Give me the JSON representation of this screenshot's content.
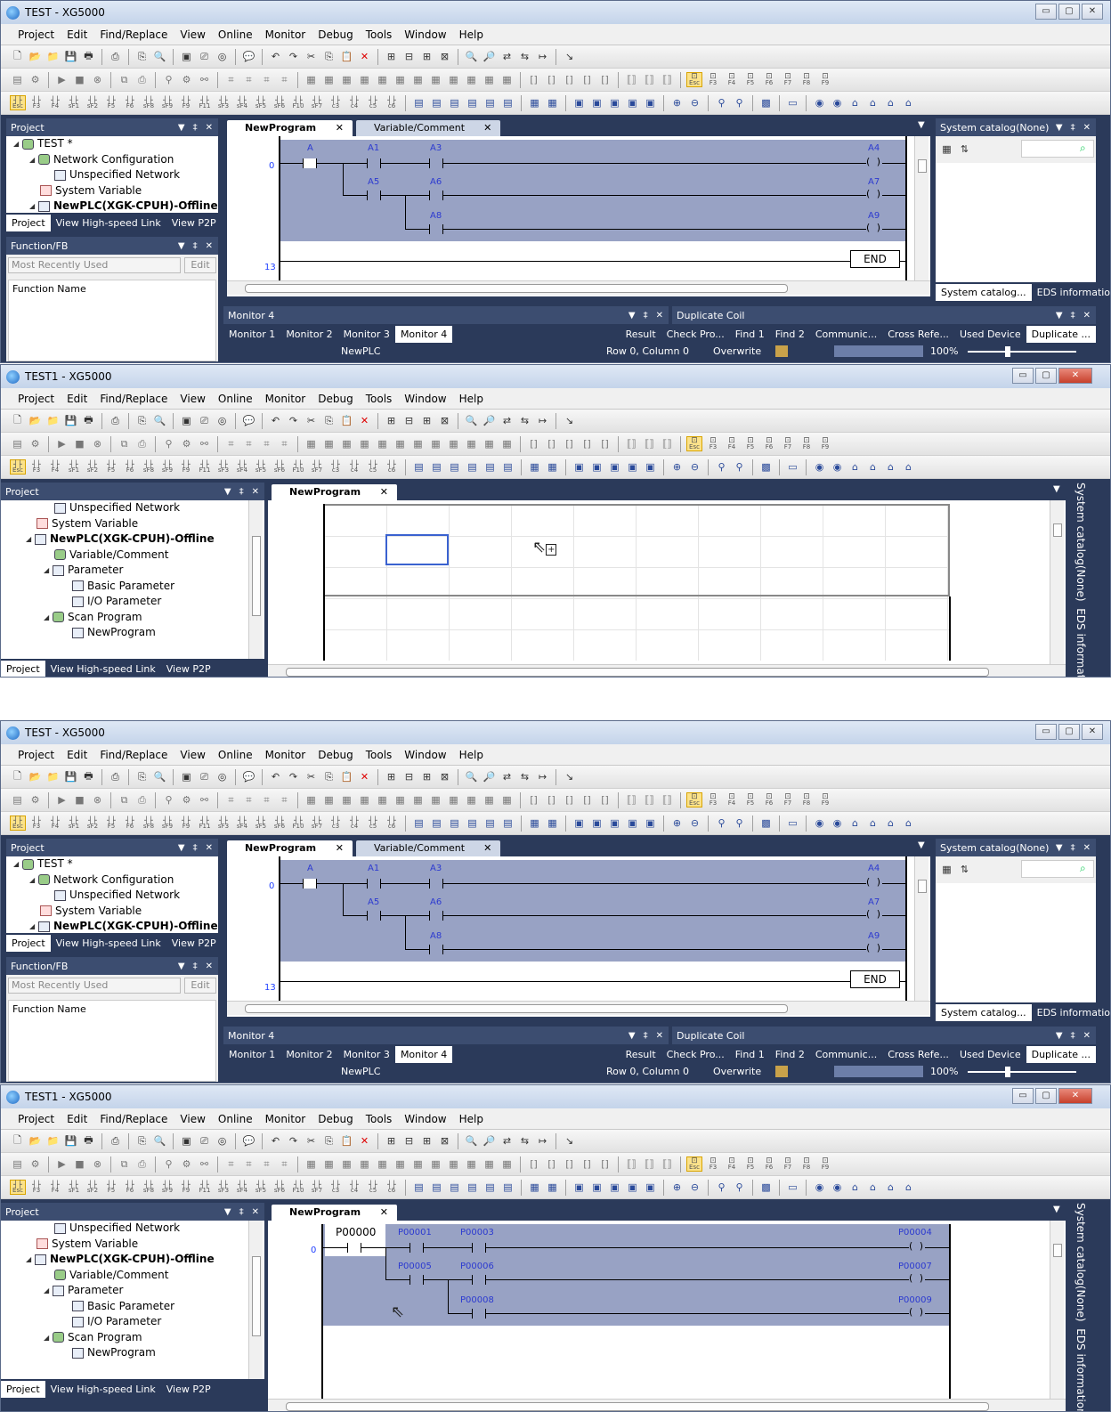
{
  "menu": [
    "Project",
    "Edit",
    "Find/Replace",
    "View",
    "Online",
    "Monitor",
    "Debug",
    "Tools",
    "Window",
    "Help"
  ],
  "fkeys": [
    [
      "Esc",
      ""
    ],
    [
      "F3",
      ""
    ],
    [
      "F4",
      ""
    ],
    [
      "sF1",
      ""
    ],
    [
      "sF2",
      ""
    ],
    [
      "F5",
      ""
    ],
    [
      "F6",
      ""
    ],
    [
      "sF8",
      ""
    ],
    [
      "sF9",
      ""
    ],
    [
      "F9",
      ""
    ],
    [
      "F11",
      ""
    ],
    [
      "sF3",
      ""
    ],
    [
      "sF4",
      ""
    ],
    [
      "sF5",
      ""
    ],
    [
      "sF6",
      ""
    ],
    [
      "F10",
      ""
    ],
    [
      "sF7",
      ""
    ],
    [
      "c3",
      ""
    ],
    [
      "c4",
      ""
    ],
    [
      "c5",
      ""
    ],
    [
      "c6",
      ""
    ]
  ],
  "fkeys2": [
    "Esc",
    "F3",
    "F4",
    "F5",
    "F6",
    "F7",
    "F8",
    "F9"
  ],
  "windows": [
    {
      "title": "TEST - XG5000",
      "project_panel": {
        "title": "Project",
        "tree": [
          "TEST *",
          "Network Configuration",
          "Unspecified Network",
          "System Variable",
          "NewPLC(XGK-CPUH)-Offline"
        ],
        "tabs": [
          "Project",
          "View High-speed Link",
          "View P2P"
        ]
      },
      "function_panel": {
        "title": "Function/FB",
        "combo": "Most Recently Used",
        "edit_button": "Edit",
        "column": "Function Name"
      },
      "doc_tabs": [
        "NewProgram",
        "Variable/Comment"
      ],
      "rung_numbers": [
        "0",
        "13"
      ],
      "contacts": [
        {
          "name": "A"
        },
        {
          "name": "A1"
        },
        {
          "name": "A3"
        },
        {
          "name": "A5"
        },
        {
          "name": "A6"
        },
        {
          "name": "A8"
        }
      ],
      "coils": [
        {
          "name": "A4"
        },
        {
          "name": "A7"
        },
        {
          "name": "A9"
        }
      ],
      "end_label": "END",
      "catalog_panel": {
        "title": "System catalog(None)",
        "tabs": [
          "System catalog...",
          "EDS information"
        ]
      },
      "monitor_panel": {
        "title": "Monitor 4",
        "tabs": [
          "Monitor 1",
          "Monitor 2",
          "Monitor 3",
          "Monitor 4"
        ]
      },
      "dup_panel": {
        "title": "Duplicate Coil",
        "tabs": [
          "Result",
          "Check Pro...",
          "Find 1",
          "Find 2",
          "Communic...",
          "Cross Refe...",
          "Used Device",
          "Duplicate ..."
        ]
      },
      "status": {
        "plc": "NewPLC",
        "position": "Row 0, Column 0",
        "mode": "Overwrite",
        "zoom": "100%"
      }
    },
    {
      "title": "TEST1 - XG5000",
      "project_panel": {
        "title": "Project",
        "tree": [
          "Unspecified Network",
          "System Variable",
          "NewPLC(XGK-CPUH)-Offline",
          "Variable/Comment",
          "Parameter",
          "Basic Parameter",
          "I/O Parameter",
          "Scan Program",
          "NewProgram"
        ],
        "tabs": [
          "Project",
          "View High-speed Link",
          "View P2P"
        ]
      },
      "doc_tabs": [
        "NewProgram"
      ],
      "side_tabs": [
        "System catalog(None)",
        "EDS information"
      ]
    },
    {
      "title": "TEST - XG5000",
      "project_panel": {
        "title": "Project",
        "tree": [
          "TEST *",
          "Network Configuration",
          "Unspecified Network",
          "System Variable",
          "NewPLC(XGK-CPUH)-Offline"
        ],
        "tabs": [
          "Project",
          "View High-speed Link",
          "View P2P"
        ]
      },
      "function_panel": {
        "title": "Function/FB",
        "combo": "Most Recently Used",
        "edit_button": "Edit",
        "column": "Function Name"
      },
      "doc_tabs": [
        "NewProgram",
        "Variable/Comment"
      ],
      "rung_numbers": [
        "0",
        "13"
      ],
      "contacts": [
        {
          "name": "A"
        },
        {
          "name": "A1"
        },
        {
          "name": "A3"
        },
        {
          "name": "A5"
        },
        {
          "name": "A6"
        },
        {
          "name": "A8"
        }
      ],
      "coils": [
        {
          "name": "A4"
        },
        {
          "name": "A7"
        },
        {
          "name": "A9"
        }
      ],
      "end_label": "END",
      "catalog_panel": {
        "title": "System catalog(None)",
        "tabs": [
          "System catalog...",
          "EDS information"
        ]
      },
      "monitor_panel": {
        "title": "Monitor 4",
        "tabs": [
          "Monitor 1",
          "Monitor 2",
          "Monitor 3",
          "Monitor 4"
        ]
      },
      "dup_panel": {
        "title": "Duplicate Coil",
        "tabs": [
          "Result",
          "Check Pro...",
          "Find 1",
          "Find 2",
          "Communic...",
          "Cross Refe...",
          "Used Device",
          "Duplicate ..."
        ]
      },
      "status": {
        "plc": "NewPLC",
        "position": "Row 0, Column 0",
        "mode": "Overwrite",
        "zoom": "100%"
      }
    },
    {
      "title": "TEST1 - XG5000",
      "project_panel": {
        "title": "Project",
        "tree": [
          "Unspecified Network",
          "System Variable",
          "NewPLC(XGK-CPUH)-Offline",
          "Variable/Comment",
          "Parameter",
          "Basic Parameter",
          "I/O Parameter",
          "Scan Program",
          "NewProgram"
        ],
        "tabs": [
          "Project",
          "View High-speed Link",
          "View P2P"
        ]
      },
      "doc_tabs": [
        "NewProgram"
      ],
      "rung_numbers": [
        "0"
      ],
      "contacts": [
        {
          "name": "P00000"
        },
        {
          "name": "P00001"
        },
        {
          "name": "P00003"
        },
        {
          "name": "P00005"
        },
        {
          "name": "P00006"
        },
        {
          "name": "P00008"
        }
      ],
      "coils": [
        {
          "name": "P00004"
        },
        {
          "name": "P00007"
        },
        {
          "name": "P00009"
        }
      ],
      "side_tabs": [
        "System catalog(None)",
        "EDS information"
      ]
    }
  ],
  "colors": {
    "frame": "#2b3a5a",
    "selection": "#98a2c4",
    "header": "#3c4d70",
    "rung_number": "#2040ff"
  }
}
